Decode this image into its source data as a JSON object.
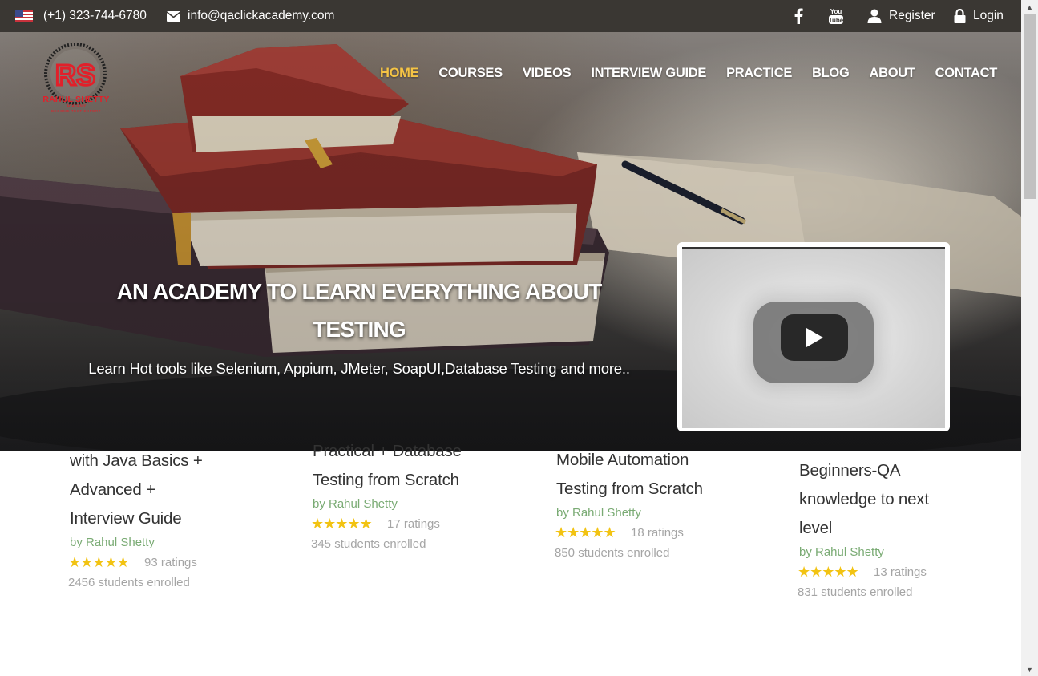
{
  "topbar": {
    "flag_icon": "us-flag-icon",
    "phone": "(+1) 323-744-6780",
    "email_icon": "envelope-icon",
    "email": "info@qaclickacademy.com",
    "social": [
      "facebook-icon",
      "youtube-icon"
    ],
    "register_label": "Register",
    "login_label": "Login"
  },
  "logo": {
    "initials": "RS",
    "name": "RAHUL SHETTY",
    "sub": "ACADEMY",
    "tagline": "BECOME TEST EXPERT"
  },
  "nav": [
    {
      "label": "HOME",
      "active": true
    },
    {
      "label": "COURSES"
    },
    {
      "label": "VIDEOS"
    },
    {
      "label": "INTERVIEW GUIDE"
    },
    {
      "label": "PRACTICE"
    },
    {
      "label": "BLOG"
    },
    {
      "label": "ABOUT"
    },
    {
      "label": "CONTACT"
    }
  ],
  "hero": {
    "headline": "AN ACADEMY TO LEARN EVERYTHING ABOUT TESTING",
    "subline": "Learn Hot tools like Selenium, Appium, JMeter, SoapUI,Database Testing and more.."
  },
  "video": {
    "play_icon": "play-icon"
  },
  "courses": [
    {
      "title_lines": [
        "with Java Basics +",
        "Advanced +",
        "Interview Guide"
      ],
      "author": "by Rahul Shetty",
      "stars": "★★★★★",
      "ratings": "93 ratings",
      "enrolled": "2456 students enrolled"
    },
    {
      "title_lines": [
        "Practical + Database",
        "Testing from Scratch"
      ],
      "author": "by Rahul Shetty",
      "stars": "★★★★★",
      "ratings": "17 ratings",
      "enrolled": "345 students enrolled"
    },
    {
      "title_lines": [
        "Mobile Automation",
        "Testing from Scratch"
      ],
      "author": "by Rahul Shetty",
      "stars": "★★★★★",
      "ratings": "18 ratings",
      "enrolled": "850 students enrolled"
    },
    {
      "title_lines": [
        "Beginners-QA",
        "knowledge to next",
        "level"
      ],
      "author": "by Rahul Shetty",
      "stars": "★★★★★",
      "ratings": "13 ratings",
      "enrolled": "831 students enrolled"
    }
  ],
  "colors": {
    "topbar_bg": "#3a3733",
    "nav_active": "#f5c445",
    "brand_red": "#e1202a",
    "author_green": "#7aab74",
    "star_yellow": "#f2c312"
  }
}
